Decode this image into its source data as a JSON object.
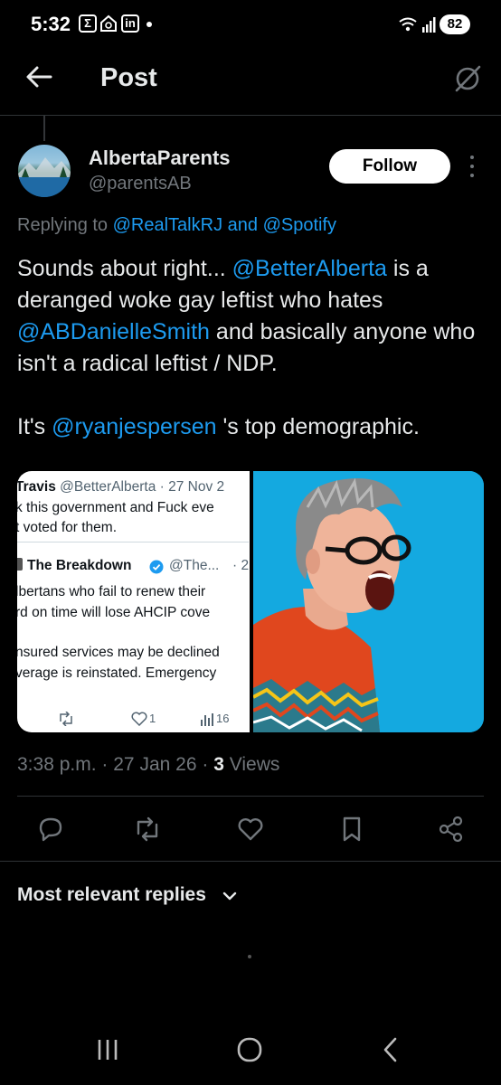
{
  "status_bar": {
    "time": "5:32",
    "icon1": "Σ",
    "icon3": "in",
    "battery": "82"
  },
  "header": {
    "title": "Post"
  },
  "post": {
    "display_name": "AlbertaParents",
    "handle": "@parentsAB",
    "follow_label": "Follow",
    "replying_prefix": "Replying to",
    "replying_to_1": "@RealTalkRJ",
    "replying_and": "and",
    "replying_to_2": "@Spotify",
    "text": {
      "p1": "Sounds about right... ",
      "m1": "@BetterAlberta",
      "p2": " is a deranged woke gay leftist who hates ",
      "m2": "@ABDanielleSmith",
      "p3": " and basically anyone who isn't a radical leftist / NDP.",
      "p4": "It's ",
      "m3": "@ryanjespersen",
      "p5": " 's top demographic."
    },
    "media": {
      "screenshot": {
        "line1_name": "Travis",
        "line1_rest": " @BetterAlberta · 27 Nov 2",
        "line2": "k this government and Fuck eve",
        "line3": "t voted for them.",
        "quoted_name": "The Breakdown",
        "quoted_handle": "@The...",
        "quoted_dot": "· 2",
        "q1": "lbertans who fail to renew their",
        "q2": "rd on time will lose AHCIP cove",
        "q3": "nsured services may be declined",
        "q4": "verage is reinstated. Emergency",
        "likes": "1",
        "views": "16"
      }
    },
    "meta_time": "3:38 p.m.",
    "meta_date": "27 Jan 26",
    "meta_views_count": "3",
    "meta_views_label": "Views",
    "meta_sep": "·"
  },
  "replies": {
    "label": "Most relevant replies"
  },
  "colors": {
    "background": "#000000",
    "accent": "#1d9bf0",
    "muted": "#71767b",
    "text": "#e7e9ea"
  }
}
